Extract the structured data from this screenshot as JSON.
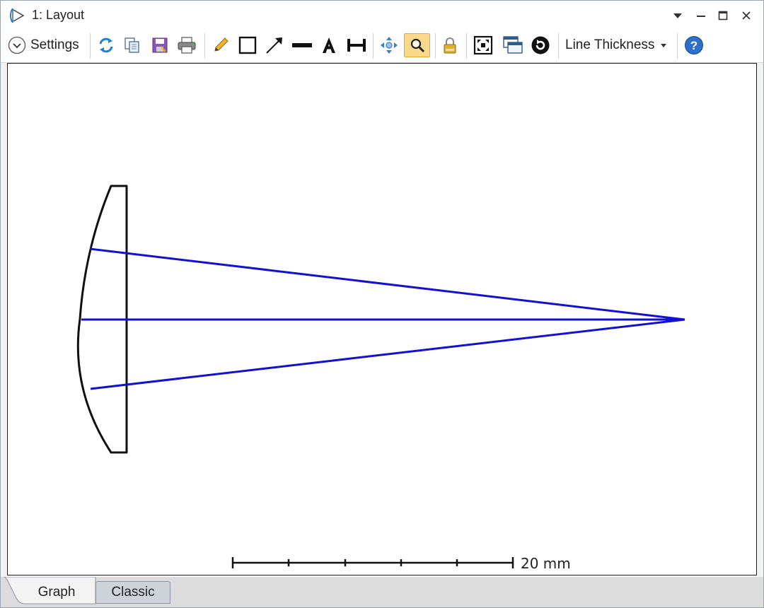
{
  "window": {
    "title": "1: Layout",
    "controls": [
      "dropdown-arrow-icon",
      "minimize-icon",
      "maximize-icon",
      "close-icon"
    ]
  },
  "toolbar": {
    "settings_label": "Settings",
    "line_thickness_label": "Line Thickness",
    "tools": [
      "refresh-icon",
      "copy-icon",
      "save-icon",
      "print-icon",
      "pencil-icon",
      "rectangle-icon",
      "arrow-icon",
      "line-icon",
      "text-icon",
      "dimension-icon",
      "pan-icon",
      "zoom-icon",
      "lock-icon",
      "fit-icon",
      "window-icon",
      "reset-icon",
      "help-icon"
    ],
    "active_tool": "zoom-icon"
  },
  "layout": {
    "scale_bar_label": "20 mm",
    "ray_color": "#1010d8",
    "lens_color": "#111111"
  },
  "tabs": [
    {
      "label": "Graph",
      "active": true
    },
    {
      "label": "Classic",
      "active": false
    }
  ]
}
